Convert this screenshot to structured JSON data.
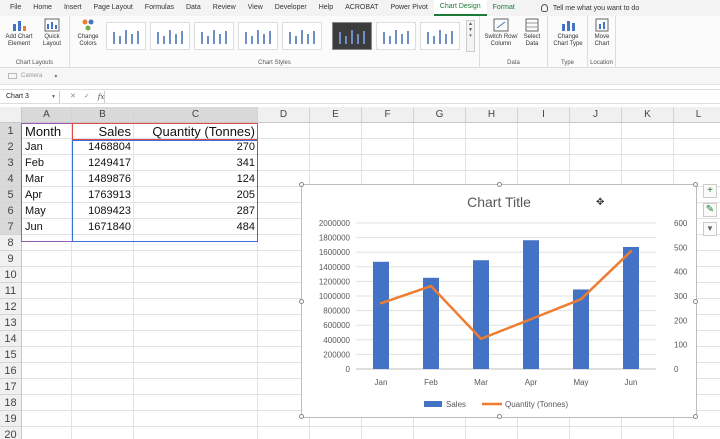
{
  "ribbon": {
    "tabs": [
      "File",
      "Home",
      "Insert",
      "Page Layout",
      "Formulas",
      "Data",
      "Review",
      "View",
      "Developer",
      "Help",
      "ACROBAT",
      "Power Pivot",
      "Chart Design",
      "Format"
    ],
    "active_tab": "Chart Design",
    "tell_me": "Tell me what you want to do",
    "buttons": {
      "add_chart_element": "Add Chart Element",
      "quick_layout": "Quick Layout",
      "change_colors": "Change Colors",
      "switch_row_column": "Switch Row/ Column",
      "select_data": "Select Data",
      "change_chart_type": "Change Chart Type",
      "move_chart": "Move Chart"
    },
    "groups": {
      "chart_layouts": "Chart Layouts",
      "chart_styles": "Chart Styles",
      "data": "Data",
      "type": "Type",
      "location": "Location"
    },
    "camera": "Camera"
  },
  "formula_bar": {
    "name_box": "Chart 3",
    "fx": "fx",
    "formula": ""
  },
  "grid": {
    "columns": [
      "A",
      "B",
      "C",
      "D",
      "E",
      "F",
      "G",
      "H",
      "I",
      "J",
      "K",
      "L"
    ],
    "rows": [
      "1",
      "2",
      "3",
      "4",
      "5",
      "6",
      "7",
      "8",
      "9",
      "10",
      "11",
      "12",
      "13",
      "14",
      "15",
      "16",
      "17",
      "18",
      "19",
      "20"
    ],
    "headers": [
      "Month",
      "Sales",
      "Quantity (Tonnes)"
    ],
    "data": [
      [
        "Jan",
        "1468804",
        "270"
      ],
      [
        "Feb",
        "1249417",
        "341"
      ],
      [
        "Mar",
        "1489876",
        "124"
      ],
      [
        "Apr",
        "1763913",
        "205"
      ],
      [
        "May",
        "1089423",
        "287"
      ],
      [
        "Jun",
        "1671840",
        "484"
      ]
    ]
  },
  "chart_data": {
    "type": "bar",
    "title": "Chart Title",
    "categories": [
      "Jan",
      "Feb",
      "Mar",
      "Apr",
      "May",
      "Jun"
    ],
    "series": [
      {
        "name": "Sales",
        "type": "bar",
        "axis": "primary",
        "color": "#4472c4",
        "values": [
          1468804,
          1249417,
          1489876,
          1763913,
          1089423,
          1671840
        ]
      },
      {
        "name": "Quantity (Tonnes)",
        "type": "line",
        "axis": "secondary",
        "color": "#ed7d31",
        "values": [
          270,
          341,
          124,
          205,
          287,
          484
        ]
      }
    ],
    "ylim": [
      0,
      2000000
    ],
    "y_ticks": [
      "0",
      "200000",
      "400000",
      "600000",
      "800000",
      "1000000",
      "1200000",
      "1400000",
      "1600000",
      "1800000",
      "2000000"
    ],
    "y2lim": [
      0,
      600
    ],
    "y2_ticks": [
      "0",
      "100",
      "200",
      "300",
      "400",
      "500",
      "600"
    ],
    "grid": true,
    "legend": "bottom"
  },
  "chart_tools": {
    "add": "+",
    "brush": "✎",
    "filter": "▼"
  }
}
